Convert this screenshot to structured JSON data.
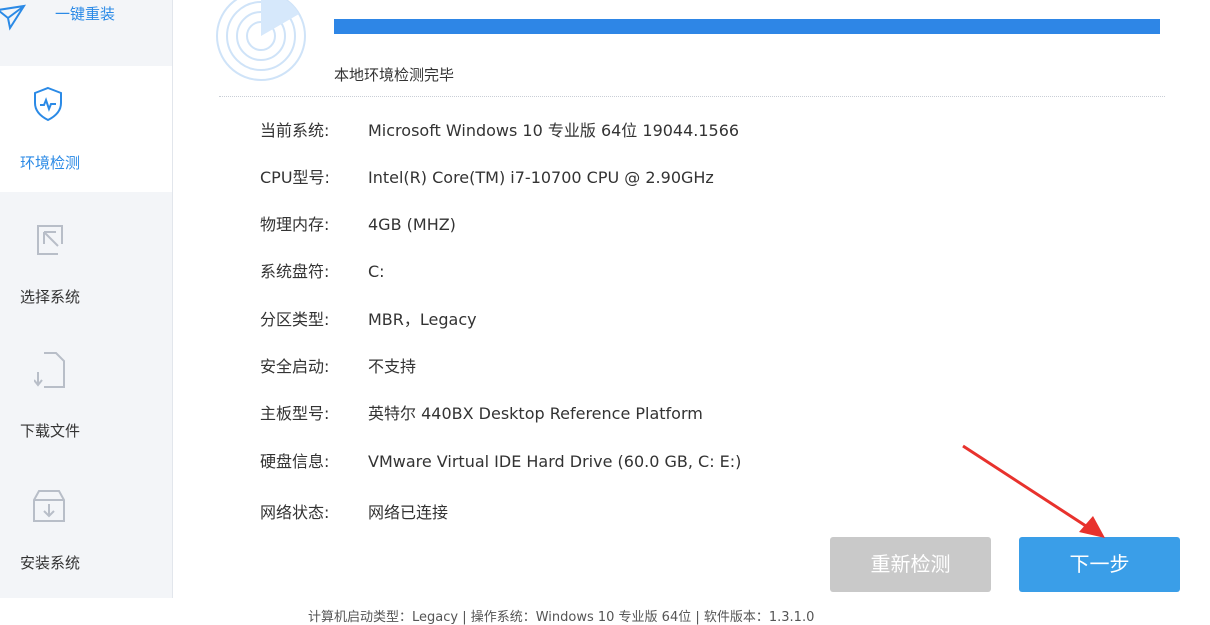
{
  "sidebar": {
    "items": [
      {
        "label": "一键重装",
        "icon": "plane-icon",
        "active": false
      },
      {
        "label": "环境检测",
        "icon": "shield-pulse-icon",
        "active": true
      },
      {
        "label": "选择系统",
        "icon": "cursor-select-icon",
        "active": false
      },
      {
        "label": "下载文件",
        "icon": "file-download-icon",
        "active": false
      },
      {
        "label": "安装系统",
        "icon": "box-install-icon",
        "active": false
      }
    ]
  },
  "progress": {
    "percent": 100
  },
  "status_text": "本地环境检测完毕",
  "info": [
    {
      "key": "当前系统:",
      "value": "Microsoft Windows 10 专业版 64位 19044.1566"
    },
    {
      "key": "CPU型号:",
      "value": "Intel(R) Core(TM) i7-10700 CPU @ 2.90GHz"
    },
    {
      "key": "物理内存:",
      "value": "4GB (MHZ)"
    },
    {
      "key": "系统盘符:",
      "value": "C:"
    },
    {
      "key": "分区类型:",
      "value": "MBR，Legacy"
    },
    {
      "key": "安全启动:",
      "value": "不支持"
    },
    {
      "key": "主板型号:",
      "value": "英特尔 440BX Desktop Reference Platform"
    },
    {
      "key": "硬盘信息:",
      "value": "VMware Virtual IDE Hard Drive  (60.0 GB, C: E:)"
    },
    {
      "key": "网络状态:",
      "value": "网络已连接"
    }
  ],
  "buttons": {
    "redetect": "重新检测",
    "next": "下一步"
  },
  "footer": "计算机启动类型：Legacy | 操作系统：Windows 10 专业版 64位 | 软件版本：1.3.1.0",
  "colors": {
    "accent": "#2e86e6",
    "arrow": "#e8322d"
  }
}
